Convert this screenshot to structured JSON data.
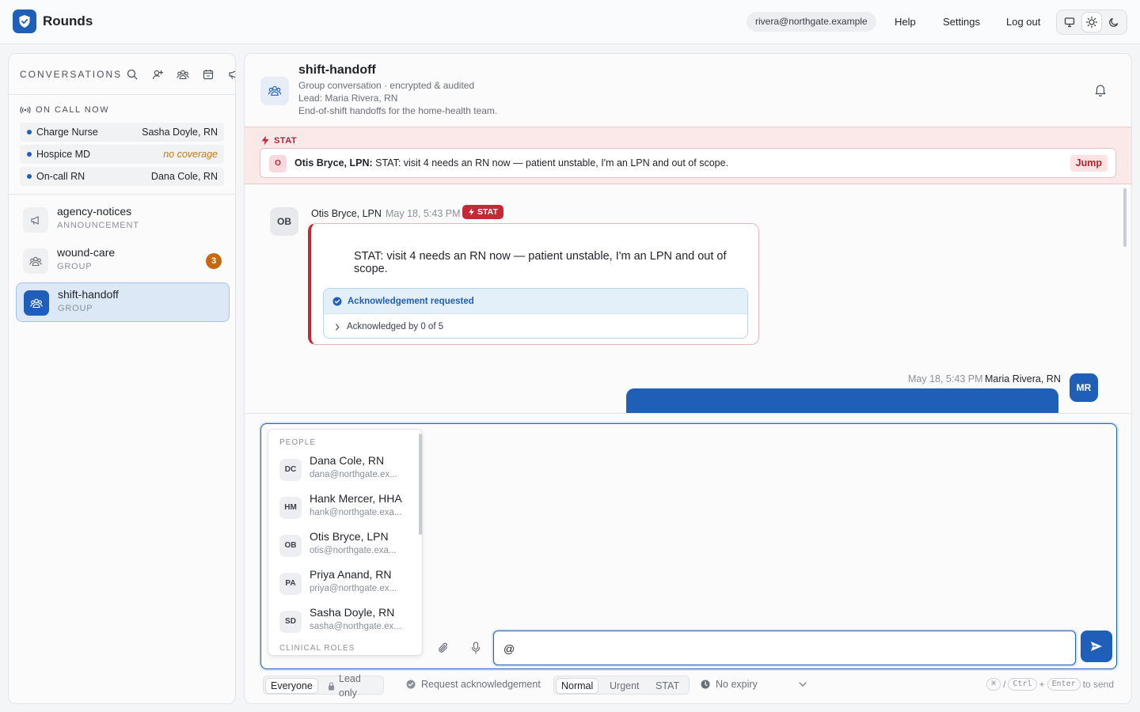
{
  "app": {
    "name": "Rounds",
    "user_email": "rivera@northgate.example",
    "nav": [
      "Help",
      "Settings",
      "Log out"
    ],
    "theme_options": [
      "monitor-icon",
      "sun-icon",
      "moon-icon"
    ],
    "theme_active": "sun-icon",
    "accent": "#1f5fb8"
  },
  "sidebar": {
    "heading": "CONVERSATIONS",
    "oncall_heading": "ON CALL NOW",
    "oncall": [
      {
        "role": "Charge Nurse",
        "who": "Sasha Doyle, RN"
      },
      {
        "role": "Hospice MD",
        "who": "no coverage"
      },
      {
        "role": "On-call RN",
        "who": "Dana Cole, RN"
      }
    ],
    "conversations": [
      {
        "name": "agency-notices",
        "type": "ANNOUNCEMENT",
        "icon": "megaphone-icon"
      },
      {
        "name": "wound-care",
        "type": "GROUP",
        "icon": "group-icon",
        "badge": "3"
      },
      {
        "name": "shift-handoff",
        "type": "GROUP",
        "icon": "group-icon",
        "active": true
      }
    ]
  },
  "channel": {
    "title": "shift-handoff",
    "subtitle": "Group conversation · encrypted & audited",
    "lead": "Lead: Maria Rivera, RN",
    "description": "End-of-shift handoffs for the home-health team."
  },
  "stat_strip": {
    "label": "STAT",
    "avatar": "O",
    "sender": "Otis Bryce, LPN:",
    "text": "STAT: visit 4 needs an RN now — patient unstable, I'm an LPN and out of scope.",
    "jump": "Jump"
  },
  "messages": [
    {
      "avatar": "OB",
      "from": "Otis Bryce, LPN",
      "time": "May 18, 5:43 PM",
      "badge": "STAT",
      "text": "STAT: visit 4 needs an RN now — patient unstable, I'm an LPN and out of scope.",
      "ack_requested": "Acknowledgement requested",
      "ack_status": "Acknowledged by 0 of 5"
    },
    {
      "avatar": "MR",
      "from": "Maria Rivera, RN",
      "time": "May 18, 5:43 PM"
    }
  ],
  "mention_menu": {
    "people_heading": "PEOPLE",
    "people": [
      {
        "initials": "DC",
        "name": "Dana Cole, RN",
        "email": "dana@northgate.ex..."
      },
      {
        "initials": "HM",
        "name": "Hank Mercer, HHA",
        "email": "hank@northgate.exa..."
      },
      {
        "initials": "OB",
        "name": "Otis Bryce, LPN",
        "email": "otis@northgate.exa..."
      },
      {
        "initials": "PA",
        "name": "Priya Anand, RN",
        "email": "priya@northgate.ex..."
      },
      {
        "initials": "SD",
        "name": "Sasha Doyle, RN",
        "email": "sasha@northgate.ex..."
      }
    ],
    "roles_heading": "CLINICAL ROLES"
  },
  "composer": {
    "input_value": "@"
  },
  "options": {
    "audience": [
      "Everyone",
      "Lead only"
    ],
    "audience_selected": "Everyone",
    "request_ack": "Request acknowledgement",
    "priority": [
      "Normal",
      "Urgent",
      "STAT"
    ],
    "priority_selected": "Normal",
    "expiry": "No expiry",
    "send_hint_keys": [
      "⌘",
      "Ctrl",
      "Enter"
    ],
    "send_hint_text": "to send",
    "send_hint_sep": "/",
    "send_hint_plus": "+"
  }
}
